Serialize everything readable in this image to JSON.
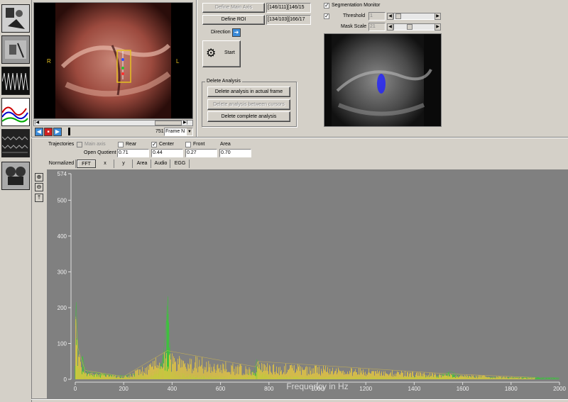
{
  "toolbar": {
    "items": [
      "patient-photo-icon",
      "recording-icon",
      "waveform-icon",
      "trajectory-chart-icon",
      "kymogram-icon",
      "camera-reels-icon"
    ]
  },
  "video": {
    "left_marker": "R",
    "right_marker": "L",
    "frame_number": "751",
    "frame_mode": "Frame N"
  },
  "controls": {
    "define_main_axis": "Define Main Axis",
    "main_axis_value": "[146/111][146/15",
    "define_roi": "Define ROI",
    "roi_value": "[134/103][166/17",
    "direction_label": "Direction",
    "start_label": "Start",
    "delete_group_title": "Delete Analysis",
    "delete_actual": "Delete analysis in actual frame",
    "delete_between": "Delete analysis between cursors",
    "delete_complete": "Delete complete analysis"
  },
  "segmentation": {
    "monitor_label": "Segmentation Monitor",
    "monitor_checked": true,
    "threshold_checked": true,
    "threshold_label": "Threshold",
    "threshold_value": "1",
    "mask_scale_label": "Mask Scale",
    "mask_scale_value": "21"
  },
  "trajectories": {
    "label": "Trajectories",
    "main_axis": "Main axis",
    "rear": "Rear",
    "center": "Center",
    "front": "Front",
    "area": "Area",
    "center_checked": true,
    "open_quotient_label": "Open Quotient",
    "values": [
      "0.71",
      "0.44",
      "0.27",
      "0.70"
    ]
  },
  "tabs": {
    "normalized": "Normalized",
    "items": [
      "FFT",
      "x",
      "y",
      "Area",
      "Audio",
      "EGG"
    ],
    "selected": "FFT"
  },
  "chart_data": {
    "type": "line",
    "xlabel": "Frequency in Hz",
    "ylabel": "",
    "xlim": [
      0,
      2000
    ],
    "ylim": [
      0,
      574
    ],
    "xticks": [
      0,
      200,
      400,
      600,
      800,
      1000,
      1200,
      1400,
      1600,
      1800,
      2000
    ],
    "yticks": [
      0,
      100,
      200,
      300,
      400,
      500,
      574
    ],
    "background": "#808080",
    "series": [
      {
        "color": "#33cc33",
        "points": [
          [
            0,
            150
          ],
          [
            4,
            216
          ],
          [
            8,
            130
          ],
          [
            14,
            75
          ],
          [
            20,
            40
          ],
          [
            30,
            65
          ],
          [
            40,
            30
          ],
          [
            60,
            20
          ],
          [
            100,
            18
          ],
          [
            150,
            12
          ],
          [
            200,
            10
          ],
          [
            250,
            15
          ],
          [
            300,
            12
          ],
          [
            340,
            25
          ],
          [
            360,
            50
          ],
          [
            370,
            110
          ],
          [
            378,
            180
          ],
          [
            383,
            232
          ],
          [
            388,
            120
          ],
          [
            395,
            50
          ],
          [
            410,
            20
          ],
          [
            500,
            10
          ],
          [
            600,
            8
          ],
          [
            700,
            10
          ],
          [
            740,
            25
          ],
          [
            750,
            55
          ],
          [
            758,
            45
          ],
          [
            765,
            25
          ],
          [
            800,
            12
          ],
          [
            900,
            8
          ],
          [
            1000,
            6
          ],
          [
            1100,
            8
          ],
          [
            1200,
            7
          ],
          [
            1300,
            6
          ],
          [
            1400,
            8
          ],
          [
            1500,
            10
          ],
          [
            1550,
            22
          ],
          [
            1600,
            8
          ],
          [
            1700,
            6
          ],
          [
            1800,
            5
          ],
          [
            1900,
            6
          ],
          [
            2000,
            4
          ]
        ]
      },
      {
        "color": "#e8c840",
        "points": [
          [
            2,
            175
          ],
          [
            10,
            90
          ],
          [
            40,
            25
          ],
          [
            200,
            8
          ],
          [
            380,
            80
          ],
          [
            745,
            35
          ],
          [
            755,
            50
          ],
          [
            1550,
            15
          ],
          [
            1900,
            5
          ]
        ]
      }
    ]
  }
}
